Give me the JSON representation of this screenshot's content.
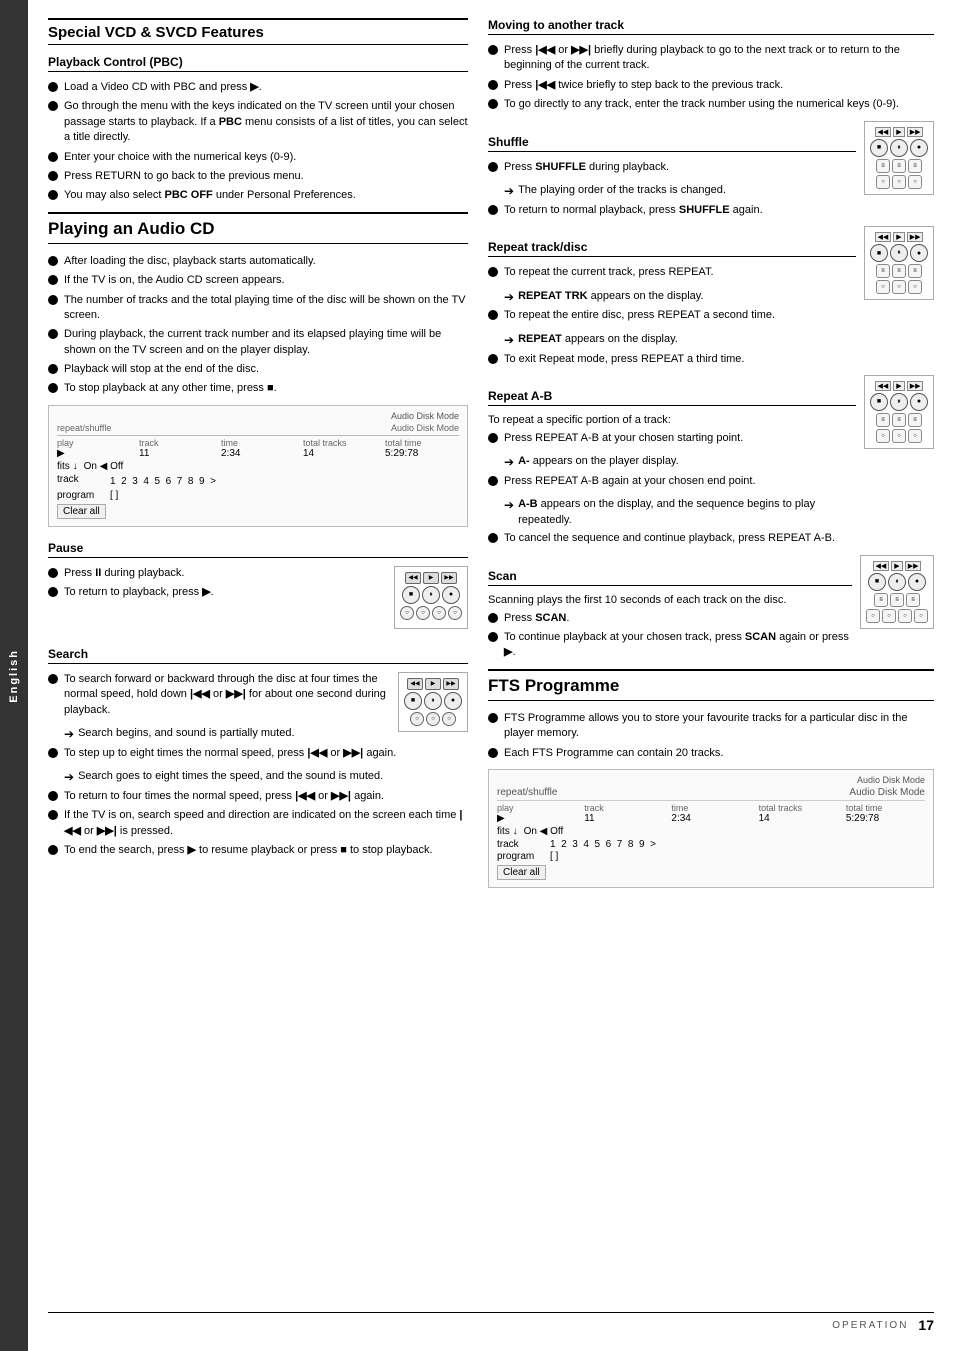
{
  "sidebar": {
    "label": "English"
  },
  "page": {
    "number": "17",
    "operation_label": "Operation"
  },
  "left": {
    "section1": {
      "title": "Special VCD & SVCD Features",
      "subsection1": {
        "title": "Playback Control (PBC)",
        "items": [
          "Load a Video CD with PBC and press ▶.",
          "Go through the menu with the keys indicated on the TV screen until your chosen passage starts to playback. If a PBC menu consists of a list of titles, you can select a title directly.",
          "Enter your choice with the numerical keys (0-9).",
          "Press RETURN to go back to the previous menu.",
          "You may also select PBC OFF under Personal Preferences."
        ]
      }
    },
    "section2": {
      "title": "Playing an Audio CD",
      "items": [
        "After loading the disc, playback starts automatically.",
        "If the TV is on, the Audio CD screen appears.",
        "The number of tracks and the total playing time of the disc will be shown on the TV screen.",
        "During playback, the current track number and its elapsed playing time will be shown on the TV screen and on the player display.",
        "Playback will stop at the end of the disc.",
        "To stop playback at any other time, press ■."
      ],
      "display": {
        "mode_label": "Audio Disk Mode",
        "col_headers": [
          "play",
          "track",
          "time",
          "total tracks",
          "total time"
        ],
        "row1": [
          "▶",
          "11",
          "2:34",
          "14",
          "5:29:78"
        ],
        "fits_label": "fits",
        "on_label": "On ◀ Off",
        "track_label": "track",
        "track_numbers": "1  2  3  4  5  6  7  8  9  >",
        "program_label": "program",
        "program_value": "[ ]",
        "clear_all": "Clear all"
      }
    },
    "pause_section": {
      "title": "Pause",
      "items": [
        "Press II during playback.",
        "To return to playback, press ▶."
      ]
    },
    "search_section": {
      "title": "Search",
      "items": [
        "To search forward or backward through the disc at four times the normal speed, hold down |◀◀ or ▶▶| for about one second during playback.",
        "→ Search begins, and sound is partially muted.",
        "To step up to eight times the normal speed, press |◀◀ or ▶▶| again.",
        "→ Search goes to eight times the speed, and the sound is muted.",
        "To return to four times the normal speed, press |◀◀ or ▶▶| again.",
        "If the TV is on, search speed and direction are indicated on the screen each time |◀◀ or ▶▶| is pressed.",
        "To end the search, press ▶ to resume playback or press ■ to stop playback."
      ]
    }
  },
  "right": {
    "moving_section": {
      "title": "Moving to another track",
      "items": [
        "Press |◀◀ or ▶▶| briefly during playback to go to the next track or to return to the beginning of the current track.",
        "Press |◀◀ twice briefly to step back to the previous track.",
        "To go directly to any track, enter the track number using the numerical keys (0-9)."
      ]
    },
    "shuffle_section": {
      "title": "Shuffle",
      "items": [
        "Press SHUFFLE during playback.",
        "→ The playing order of the tracks is changed.",
        "To return to normal playback, press SHUFFLE again."
      ]
    },
    "repeat_track_section": {
      "title": "Repeat track/disc",
      "items": [
        "To repeat the current track, press REPEAT.",
        "→ REPEAT TRK appears on the display.",
        "To repeat the entire disc, press REPEAT a second time.",
        "→ REPEAT appears on the display.",
        "To exit Repeat mode, press REPEAT a third time."
      ]
    },
    "repeat_ab_section": {
      "title": "Repeat A-B",
      "items": [
        "To repeat a specific portion of a track:",
        "Press REPEAT A-B at your chosen starting point.",
        "→ A- appears on the player display.",
        "Press REPEAT A-B again at your chosen end point.",
        "→ A-B appears on the display, and the sequence begins to play repeatedly.",
        "To cancel the sequence and continue playback, press REPEAT A-B."
      ]
    },
    "scan_section": {
      "title": "Scan",
      "description": "Scanning plays the first 10 seconds of each track on the disc.",
      "items": [
        "Press SCAN.",
        "To continue playback at your chosen track, press SCAN again or press ▶."
      ]
    },
    "fts_section": {
      "title": "FTS Programme",
      "items": [
        "FTS Programme allows you to store your favourite tracks for a particular disc in the player memory.",
        "Each FTS Programme can contain 20 tracks."
      ],
      "display": {
        "mode_label": "Audio Disk Mode",
        "col_headers": [
          "play",
          "track",
          "time",
          "total tracks",
          "total time"
        ],
        "row1": [
          "▶",
          "11",
          "2:34",
          "14",
          "5:29:78"
        ],
        "fits_label": "fits",
        "on_label": "On ◀ Off",
        "track_label": "track",
        "track_numbers": "1  2  3  4  5  6  7  8  9  >",
        "program_label": "program",
        "program_value": "[ ]",
        "clear_all": "Clear all"
      }
    }
  },
  "remote_buttons": {
    "pause_remote": {
      "row1": [
        "◀◀",
        "▶",
        "▶▶"
      ],
      "row2": [
        "⏹",
        "⏸",
        "⏺"
      ],
      "row3": [
        "○",
        "○",
        "○",
        "○"
      ]
    }
  }
}
